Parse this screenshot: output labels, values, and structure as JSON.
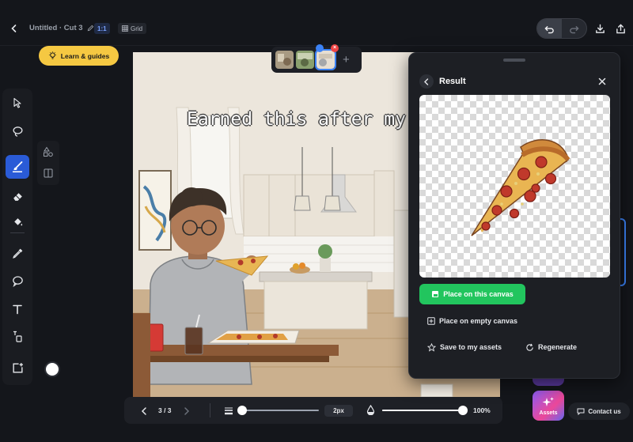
{
  "header": {
    "title": "Untitled · Cut 3",
    "ratio": "1:1",
    "grid_label": "Grid"
  },
  "learn_button": {
    "label": "Learn & guides"
  },
  "canvas": {
    "caption": "Earned this after my w"
  },
  "bottom_bar": {
    "page_indicator": "3 / 3",
    "brush_size": "2px",
    "brush_size_fraction": 0.05,
    "opacity": "100%",
    "opacity_fraction": 1.0
  },
  "result_panel": {
    "title": "Result",
    "place_on_canvas": "Place on this canvas",
    "place_on_empty": "Place on empty canvas",
    "save_assets": "Save to my assets",
    "regenerate": "Regenerate"
  },
  "assets_button": {
    "label": "Assets"
  },
  "contact_button": {
    "label": "Contact us"
  },
  "colors": {
    "accent_blue": "#2a5bd7",
    "learn_yellow": "#f5c842",
    "primary_green": "#22c55e",
    "close_red": "#ef4444",
    "current_color": "#ffffff"
  }
}
